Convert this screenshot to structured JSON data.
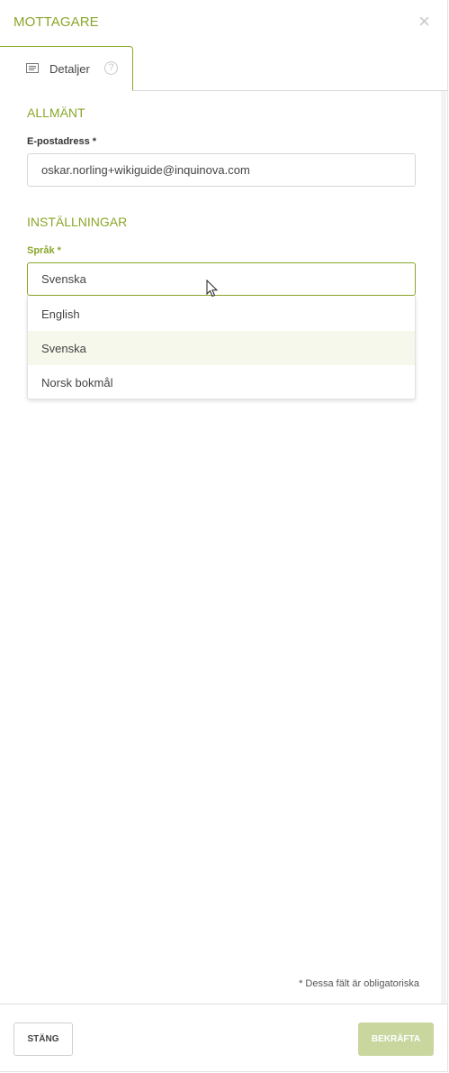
{
  "header": {
    "title": "MOTTAGARE",
    "close_icon": "×"
  },
  "tabs": [
    {
      "label": "Detaljer",
      "icon": "list-card-icon",
      "help_icon": "?"
    }
  ],
  "sections": {
    "general": {
      "title": "ALLMÄNT",
      "email_label": "E-postadress *",
      "email_value": "oskar.norling+wikiguide@inquinova.com"
    },
    "settings": {
      "title": "INSTÄLLNINGAR",
      "language_label": "Språk *",
      "language_value": "Svenska",
      "language_options": [
        "English",
        "Svenska",
        "Norsk bokmål"
      ]
    }
  },
  "required_note": "* Dessa fält är obligatoriska",
  "footer": {
    "close_label": "STÄNG",
    "confirm_label": "BEKRÄFTA"
  },
  "colors": {
    "accent": "#8aa62a",
    "selected_option_bg": "#f6f8ec",
    "confirm_disabled": "#c9d79f"
  }
}
